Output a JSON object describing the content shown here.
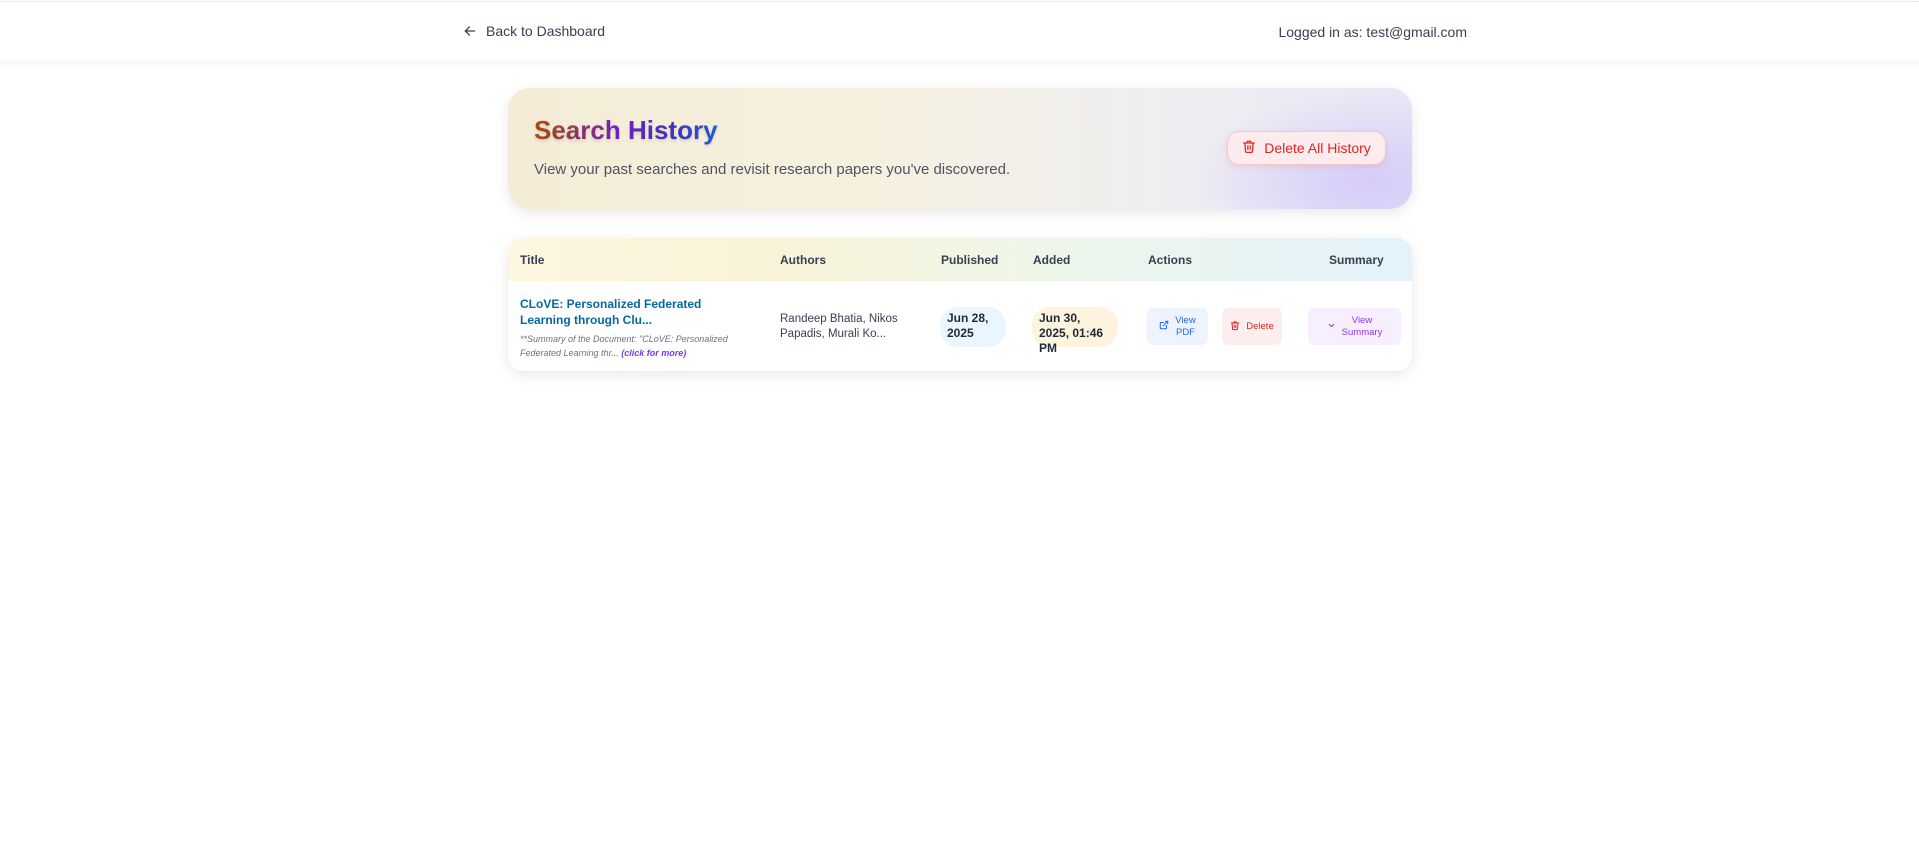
{
  "nav": {
    "back_label": "Back to Dashboard",
    "logged_in_text": "Logged in as: test@gmail.com"
  },
  "header": {
    "title": "Search History",
    "subtitle": "View your past searches and revisit research papers you've discovered.",
    "delete_all_label": "Delete All History"
  },
  "table": {
    "columns": {
      "title": "Title",
      "authors": "Authors",
      "published": "Published",
      "added": "Added",
      "actions": "Actions",
      "summary": "Summary"
    },
    "rows": [
      {
        "title": "CLoVE: Personalized Federated Learning through Clu...",
        "summary_snippet": "**Summary of the Document: \"CLoVE: Personalized Federated Learning thr...",
        "click_more": "(click for more)",
        "authors": "Randeep Bhatia, Nikos Papadis, Murali Ko...",
        "published": "Jun 28, 2025",
        "added": "Jun 30, 2025, 01:46 PM",
        "view_pdf_line1": "View",
        "view_pdf_line2": "PDF",
        "delete_label": "Delete",
        "view_summary_line1": "View",
        "view_summary_line2": "Summary"
      }
    ]
  },
  "colors": {
    "accent_blue": "#0369a1",
    "danger_red": "#dc2626",
    "purple": "#9333ea"
  },
  "icons": {
    "back": "arrow-left-icon",
    "trash": "trash-icon",
    "external_link": "external-link-icon",
    "chevron": "chevron-down-icon"
  }
}
